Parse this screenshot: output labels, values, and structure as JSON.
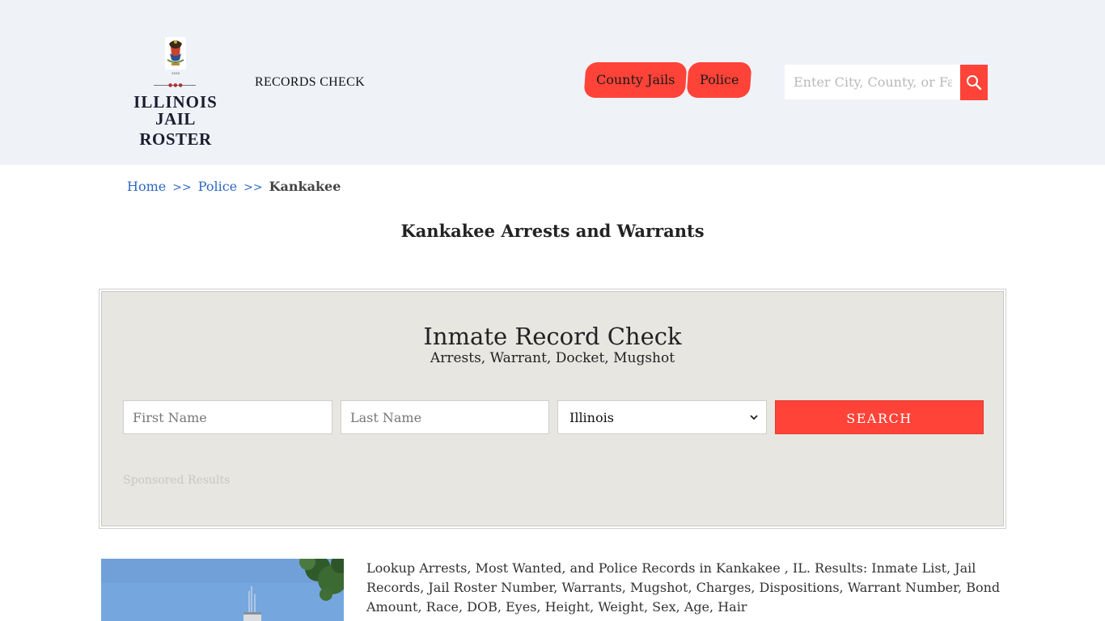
{
  "header": {
    "logo": {
      "line1": "ILLINOIS",
      "line2": "JAIL ROSTER",
      "seal_icon": "illinois-state-seal-icon"
    },
    "records_check": "RECORDS CHECK",
    "nav": [
      {
        "label": "County Jails"
      },
      {
        "label": "Police"
      }
    ],
    "search": {
      "placeholder": "Enter City, County, or Facility",
      "icon": "search-icon"
    }
  },
  "breadcrumb": {
    "home": "Home",
    "separator": ">>",
    "police": "Police",
    "current": "Kankakee"
  },
  "page": {
    "title": "Kankakee Arrests and Warrants"
  },
  "record_check": {
    "title": "Inmate Record Check",
    "subtitle": "Arrests, Warrant, Docket, Mugshot",
    "first_name_placeholder": "First Name",
    "last_name_placeholder": "Last Name",
    "state_selected": "Illinois",
    "submit_label": "SEARCH",
    "sponsored": "Sponsored Results"
  },
  "content": {
    "description": "Lookup Arrests, Most Wanted, and Police Records in Kankakee , IL. Results: Inmate List, Jail Records, Jail Roster Number, Warrants, Mugshot, Charges, Dispositions, Warrant Number, Bond Amount, Race, DOB, Eyes, Height, Weight, Sex, Age, Hair"
  },
  "colors": {
    "header_bg": "#eff3f8",
    "accent": "#ff4338",
    "link": "#2d68c4",
    "panel_bg": "#e8e6e1"
  }
}
